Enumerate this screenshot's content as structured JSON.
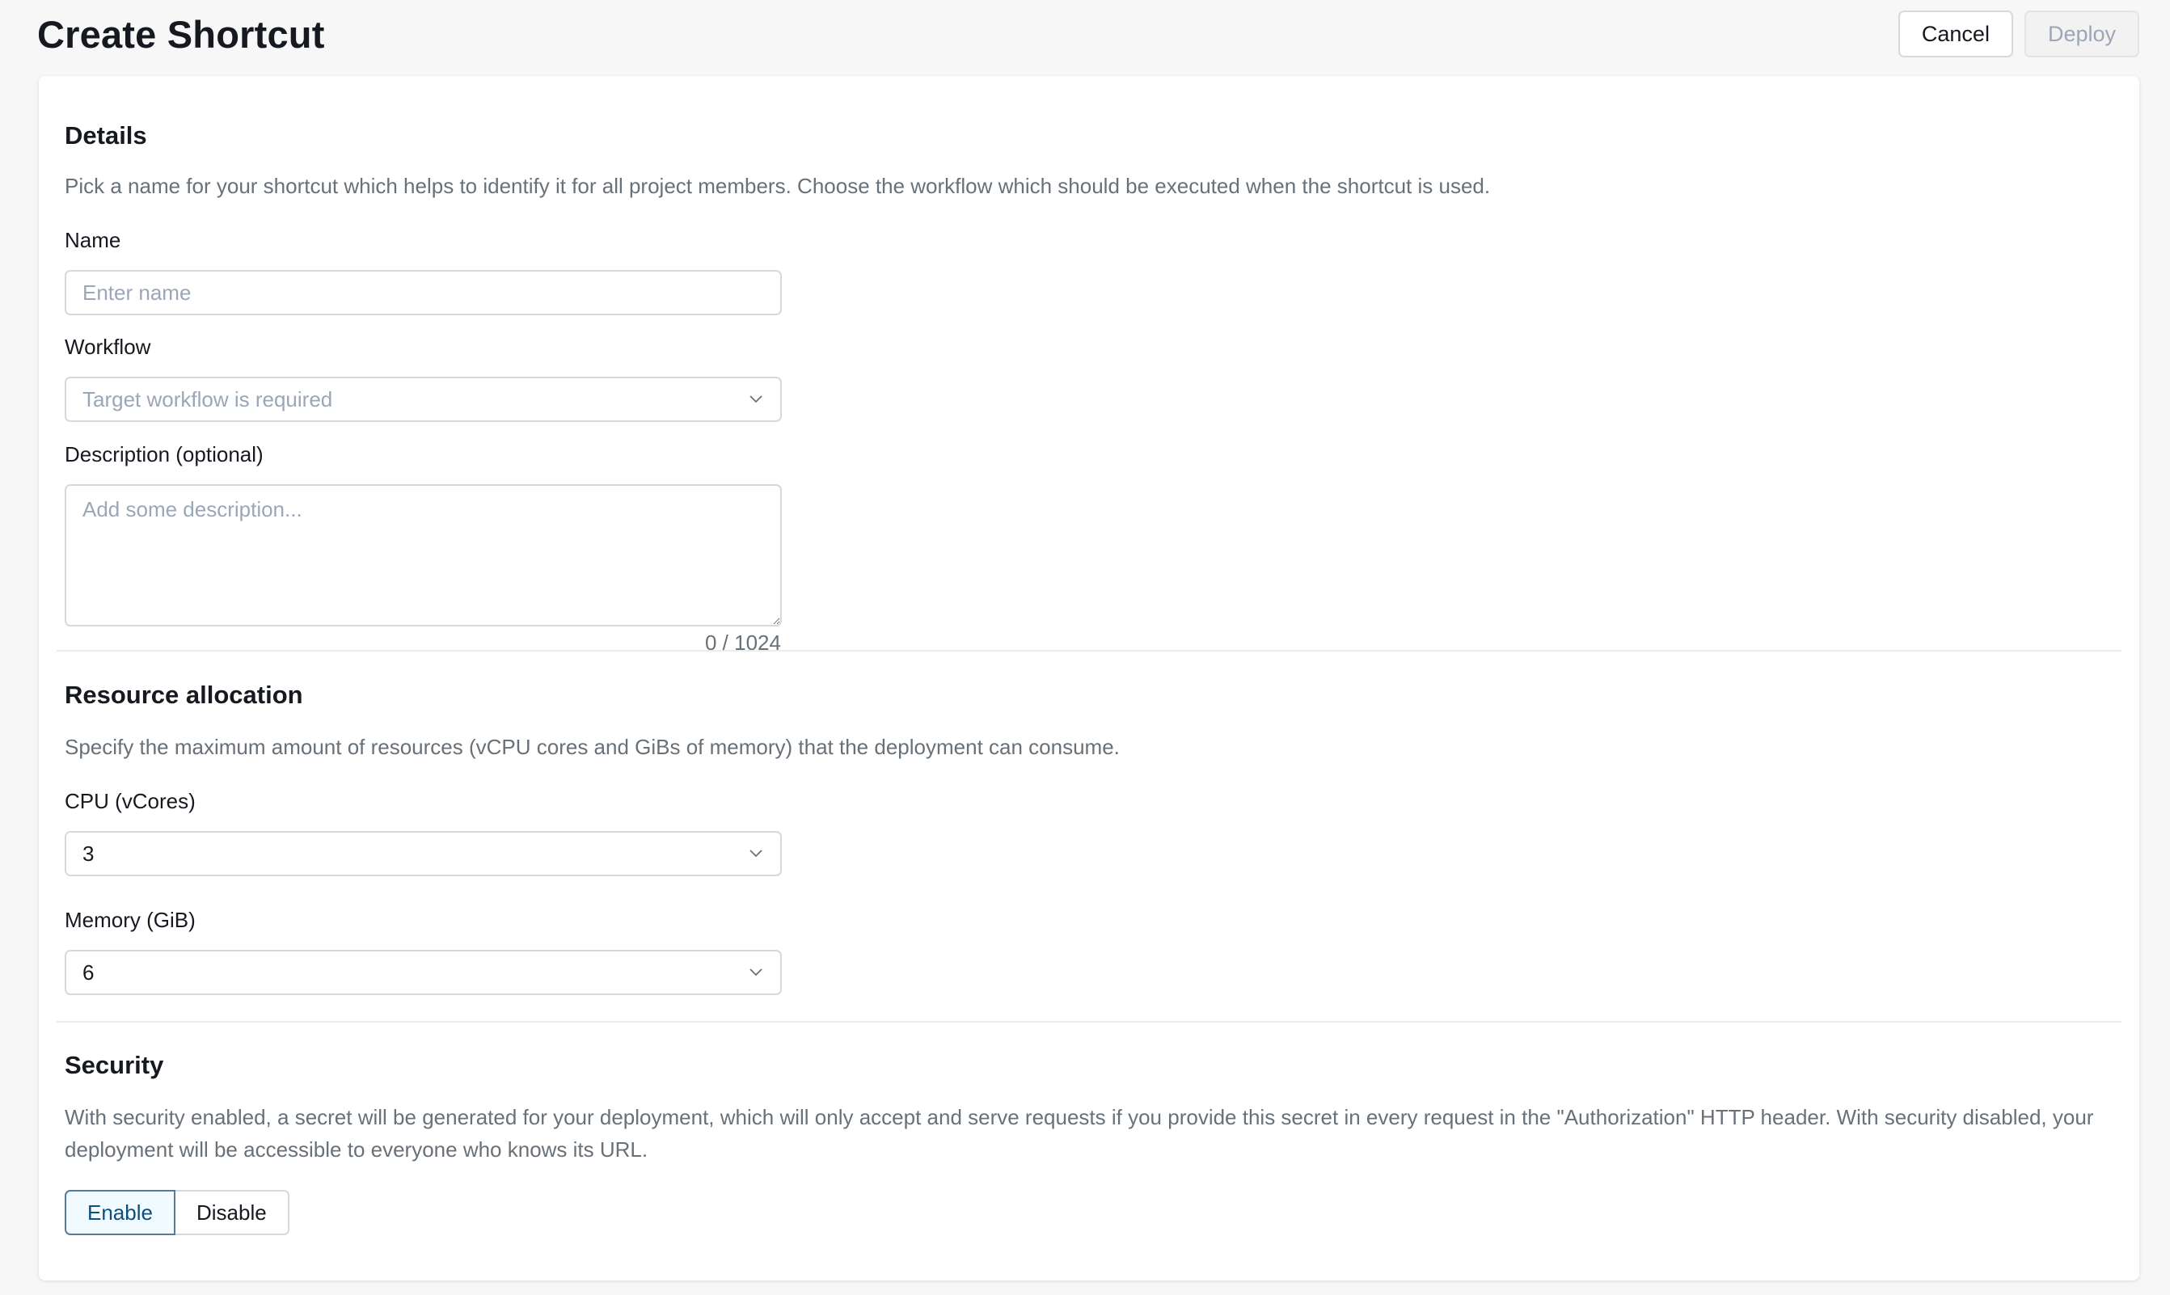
{
  "header": {
    "title": "Create Shortcut",
    "cancel_label": "Cancel",
    "deploy_label": "Deploy"
  },
  "details": {
    "title": "Details",
    "description": "Pick a name for your shortcut which helps to identify it for all project members. Choose the workflow which should be executed when the shortcut is used.",
    "name_label": "Name",
    "name_placeholder": "Enter name",
    "name_value": "",
    "workflow_label": "Workflow",
    "workflow_placeholder": "Target workflow is required",
    "description_label": "Description (optional)",
    "description_placeholder": "Add some description...",
    "description_counter": "0 / 1024"
  },
  "resources": {
    "title": "Resource allocation",
    "description": "Specify the maximum amount of resources (vCPU cores and GiBs of memory) that the deployment can consume.",
    "cpu_label": "CPU (vCores)",
    "cpu_value": "3",
    "memory_label": "Memory (GiB)",
    "memory_value": "6"
  },
  "security": {
    "title": "Security",
    "description": "With security enabled, a secret will be generated for your deployment, which will only accept and serve requests if you provide this secret in every request in the \"Authorization\" HTTP header. With security disabled, your deployment will be accessible to everyone who knows its URL.",
    "enable_label": "Enable",
    "disable_label": "Disable",
    "selected": "Enable"
  },
  "colors": {
    "accent_selected_border": "#5a7a93",
    "text_primary": "#16191f",
    "text_secondary": "#687078",
    "placeholder": "#9ba7b6"
  }
}
